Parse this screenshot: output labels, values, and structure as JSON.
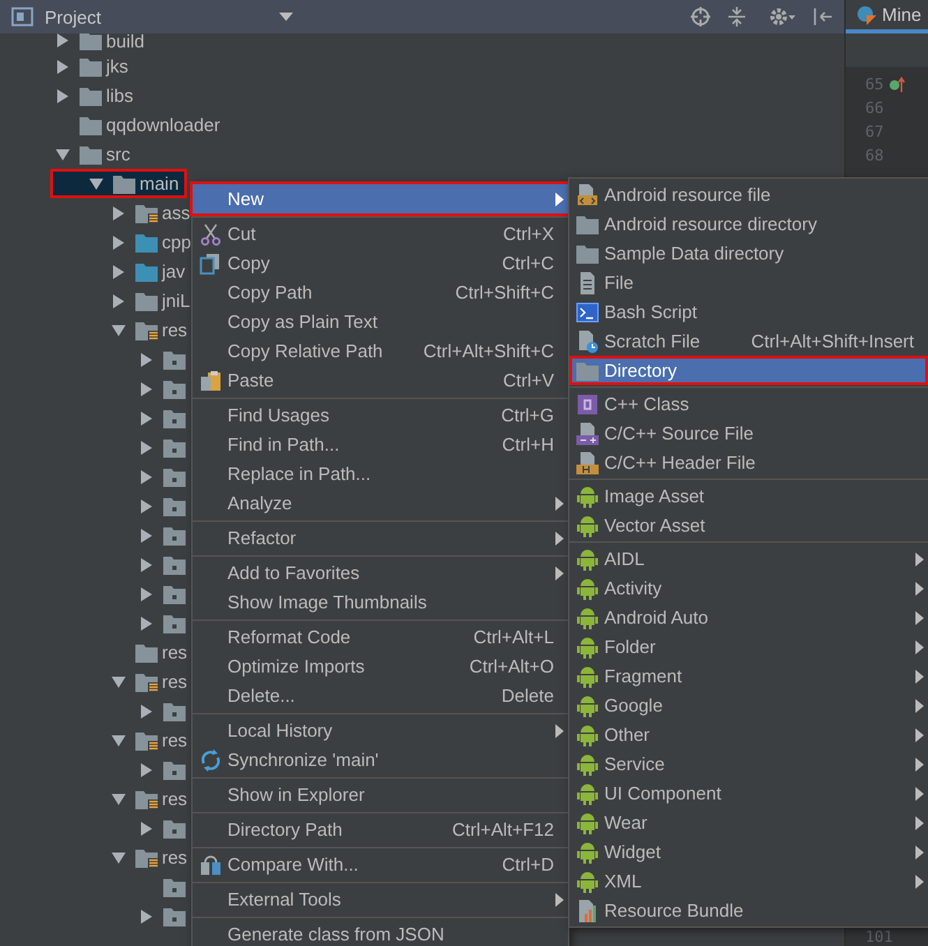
{
  "panel": {
    "title": "Project"
  },
  "tree": [
    {
      "label": "build",
      "kind": "folder",
      "expanded": false,
      "selected": false
    },
    {
      "label": "jks",
      "kind": "folder",
      "expanded": false,
      "selected": false
    },
    {
      "label": "libs",
      "kind": "folder",
      "expanded": false,
      "selected": false
    },
    {
      "label": "qqdownloader",
      "kind": "folder",
      "selected": false
    },
    {
      "label": "src",
      "kind": "folder",
      "expanded": true,
      "selected": false,
      "children": [
        {
          "label": "main",
          "kind": "folder",
          "expanded": true,
          "selected": true,
          "children": [
            {
              "label": "ass",
              "kind": "resource",
              "expanded": false,
              "selected": false
            },
            {
              "label": "cpp",
              "kind": "source",
              "expanded": false,
              "selected": false
            },
            {
              "label": "jav",
              "kind": "source",
              "expanded": false,
              "selected": false
            },
            {
              "label": "jniL",
              "kind": "folder",
              "expanded": false,
              "selected": false
            },
            {
              "label": "res",
              "kind": "resource",
              "expanded": true,
              "selected": false,
              "children": [
                {
                  "kind": "package",
                  "expanded": false,
                  "selected": false
                },
                {
                  "kind": "package",
                  "expanded": false,
                  "selected": false
                },
                {
                  "kind": "package",
                  "expanded": false,
                  "selected": false
                },
                {
                  "kind": "package",
                  "expanded": false,
                  "selected": false
                },
                {
                  "kind": "package",
                  "expanded": false,
                  "selected": false
                },
                {
                  "kind": "package",
                  "expanded": false,
                  "selected": false
                },
                {
                  "kind": "package",
                  "expanded": false,
                  "selected": false
                },
                {
                  "kind": "package",
                  "expanded": false,
                  "selected": false
                },
                {
                  "kind": "package",
                  "expanded": false,
                  "selected": false
                },
                {
                  "kind": "package",
                  "expanded": false,
                  "selected": false
                }
              ]
            },
            {
              "label": "res",
              "kind": "folder",
              "selected": false
            },
            {
              "label": "res",
              "kind": "resource",
              "expanded": true,
              "selected": false,
              "children": [
                {
                  "kind": "package",
                  "expanded": false,
                  "selected": false
                }
              ]
            },
            {
              "label": "res",
              "kind": "resource",
              "expanded": true,
              "selected": false,
              "children": [
                {
                  "kind": "package",
                  "expanded": false,
                  "selected": false
                }
              ]
            },
            {
              "label": "res",
              "kind": "resource",
              "expanded": true,
              "selected": false,
              "children": [
                {
                  "kind": "package",
                  "expanded": false,
                  "selected": false
                }
              ]
            },
            {
              "label": "res",
              "kind": "resource",
              "expanded": true,
              "selected": false,
              "children": [
                {
                  "kind": "package",
                  "selected": false
                },
                {
                  "kind": "package",
                  "expanded": false,
                  "selected": false
                }
              ]
            }
          ]
        }
      ]
    }
  ],
  "editor": {
    "tab": "Mine",
    "lines": [
      {
        "number": "65",
        "marker": true
      },
      {
        "number": "66",
        "marker": false
      },
      {
        "number": "67",
        "marker": false
      },
      {
        "number": "68",
        "marker": false
      }
    ],
    "last_line": "101"
  },
  "context_menu": [
    {
      "kind": "plain",
      "label": "New",
      "submenu": true,
      "selected": true
    },
    {
      "kind": "separator"
    },
    {
      "kind": "cut",
      "label": "Cut",
      "shortcut": "Ctrl+X",
      "selected": false
    },
    {
      "kind": "copy",
      "label": "Copy",
      "shortcut": "Ctrl+C",
      "selected": false
    },
    {
      "kind": "plain",
      "label": "Copy Path",
      "shortcut": "Ctrl+Shift+C",
      "selected": false
    },
    {
      "kind": "plain",
      "label": "Copy as Plain Text",
      "selected": false
    },
    {
      "kind": "plain",
      "label": "Copy Relative Path",
      "shortcut": "Ctrl+Alt+Shift+C",
      "selected": false
    },
    {
      "kind": "paste",
      "label": "Paste",
      "shortcut": "Ctrl+V",
      "selected": false
    },
    {
      "kind": "separator"
    },
    {
      "kind": "plain",
      "label": "Find Usages",
      "shortcut": "Ctrl+G",
      "selected": false
    },
    {
      "kind": "plain",
      "label": "Find in Path...",
      "shortcut": "Ctrl+H",
      "selected": false
    },
    {
      "kind": "plain",
      "label": "Replace in Path...",
      "selected": false
    },
    {
      "kind": "plain",
      "label": "Analyze",
      "submenu": true,
      "selected": false
    },
    {
      "kind": "separator"
    },
    {
      "kind": "plain",
      "label": "Refactor",
      "submenu": true,
      "selected": false
    },
    {
      "kind": "separator"
    },
    {
      "kind": "plain",
      "label": "Add to Favorites",
      "submenu": true,
      "selected": false
    },
    {
      "kind": "plain",
      "label": "Show Image Thumbnails",
      "selected": false
    },
    {
      "kind": "separator"
    },
    {
      "kind": "plain",
      "label": "Reformat Code",
      "shortcut": "Ctrl+Alt+L",
      "selected": false
    },
    {
      "kind": "plain",
      "label": "Optimize Imports",
      "shortcut": "Ctrl+Alt+O",
      "selected": false
    },
    {
      "kind": "plain",
      "label": "Delete...",
      "shortcut": "Delete",
      "selected": false
    },
    {
      "kind": "separator"
    },
    {
      "kind": "plain",
      "label": "Local History",
      "submenu": true,
      "selected": false
    },
    {
      "kind": "sync",
      "label": "Synchronize 'main'",
      "selected": false
    },
    {
      "kind": "separator"
    },
    {
      "kind": "plain",
      "label": "Show in Explorer",
      "selected": false
    },
    {
      "kind": "separator"
    },
    {
      "kind": "plain",
      "label": "Directory Path",
      "shortcut": "Ctrl+Alt+F12",
      "selected": false
    },
    {
      "kind": "separator"
    },
    {
      "kind": "compare",
      "label": "Compare With...",
      "shortcut": "Ctrl+D",
      "selected": false
    },
    {
      "kind": "separator"
    },
    {
      "kind": "plain",
      "label": "External Tools",
      "submenu": true,
      "selected": false
    },
    {
      "kind": "separator"
    },
    {
      "kind": "plain",
      "label": "Generate class from JSON",
      "selected": false
    }
  ],
  "submenu": [
    {
      "kind": "resource-file",
      "label": "Android resource file",
      "selected": false
    },
    {
      "kind": "folder",
      "label": "Android resource directory",
      "selected": false
    },
    {
      "kind": "folder",
      "label": "Sample Data directory",
      "selected": false
    },
    {
      "kind": "file",
      "label": "File",
      "selected": false
    },
    {
      "kind": "bash",
      "label": "Bash Script",
      "selected": false
    },
    {
      "kind": "scratch",
      "label": "Scratch File",
      "shortcut": "Ctrl+Alt+Shift+Insert",
      "selected": false
    },
    {
      "kind": "folder",
      "label": "Directory",
      "selected": true
    },
    {
      "kind": "separator"
    },
    {
      "kind": "class",
      "label": "C++ Class",
      "selected": false
    },
    {
      "kind": "source",
      "label": "C/C++ Source File",
      "selected": false
    },
    {
      "kind": "header",
      "label": "C/C++ Header File",
      "selected": false
    },
    {
      "kind": "separator"
    },
    {
      "kind": "android",
      "label": "Image Asset",
      "selected": false
    },
    {
      "kind": "android",
      "label": "Vector Asset",
      "selected": false
    },
    {
      "kind": "separator"
    },
    {
      "kind": "android",
      "label": "AIDL",
      "submenu": true,
      "selected": false
    },
    {
      "kind": "android",
      "label": "Activity",
      "submenu": true,
      "selected": false
    },
    {
      "kind": "android",
      "label": "Android Auto",
      "submenu": true,
      "selected": false
    },
    {
      "kind": "android",
      "label": "Folder",
      "submenu": true,
      "selected": false
    },
    {
      "kind": "android",
      "label": "Fragment",
      "submenu": true,
      "selected": false
    },
    {
      "kind": "android",
      "label": "Google",
      "submenu": true,
      "selected": false
    },
    {
      "kind": "android",
      "label": "Other",
      "submenu": true,
      "selected": false
    },
    {
      "kind": "android",
      "label": "Service",
      "submenu": true,
      "selected": false
    },
    {
      "kind": "android",
      "label": "UI Component",
      "submenu": true,
      "selected": false
    },
    {
      "kind": "android",
      "label": "Wear",
      "submenu": true,
      "selected": false
    },
    {
      "kind": "android",
      "label": "Widget",
      "submenu": true,
      "selected": false
    },
    {
      "kind": "android",
      "label": "XML",
      "submenu": true,
      "selected": false
    },
    {
      "kind": "bundle",
      "label": "Resource Bundle",
      "selected": false
    }
  ]
}
